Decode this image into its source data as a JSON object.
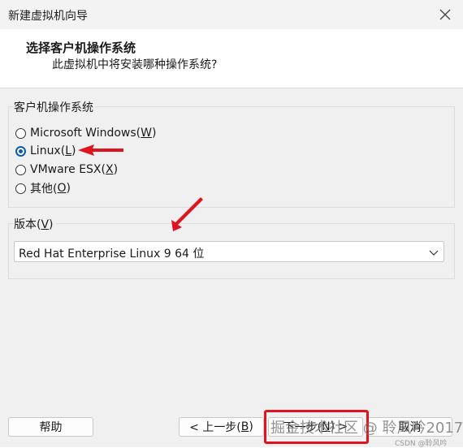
{
  "window": {
    "title": "新建虚拟机向导"
  },
  "header": {
    "title": "选择客户机操作系统",
    "subtitle": "此虚拟机中将安装哪种操作系统?"
  },
  "guest_os": {
    "label": "客户机操作系统",
    "options": [
      {
        "text": "Microsoft Windows(",
        "key": "W",
        "tail": ")",
        "selected": false
      },
      {
        "text": "Linux(",
        "key": "L",
        "tail": ")",
        "selected": true
      },
      {
        "text": "VMware ESX(",
        "key": "X",
        "tail": ")",
        "selected": false
      },
      {
        "text": "其他(",
        "key": "O",
        "tail": ")",
        "selected": false
      }
    ]
  },
  "version": {
    "label_pre": "版本(",
    "label_key": "V",
    "label_post": ")",
    "selected": "Red Hat Enterprise Linux 9 64 位"
  },
  "buttons": {
    "help": "帮助",
    "back_pre": "< 上一步(",
    "back_key": "B",
    "back_post": ")",
    "next_pre": "下一步(",
    "next_key": "N",
    "next_post": ") >",
    "cancel": "取消"
  },
  "watermark": {
    "main": "掘金技术社区 @ 聆风吟2017",
    "sub": "CSDN @聆风吟"
  },
  "colors": {
    "annotation_red": "#e0141e",
    "radio_selected": "#0b5cad"
  },
  "icons": {
    "close": "close-icon",
    "dropdown": "chevron-down-icon"
  }
}
